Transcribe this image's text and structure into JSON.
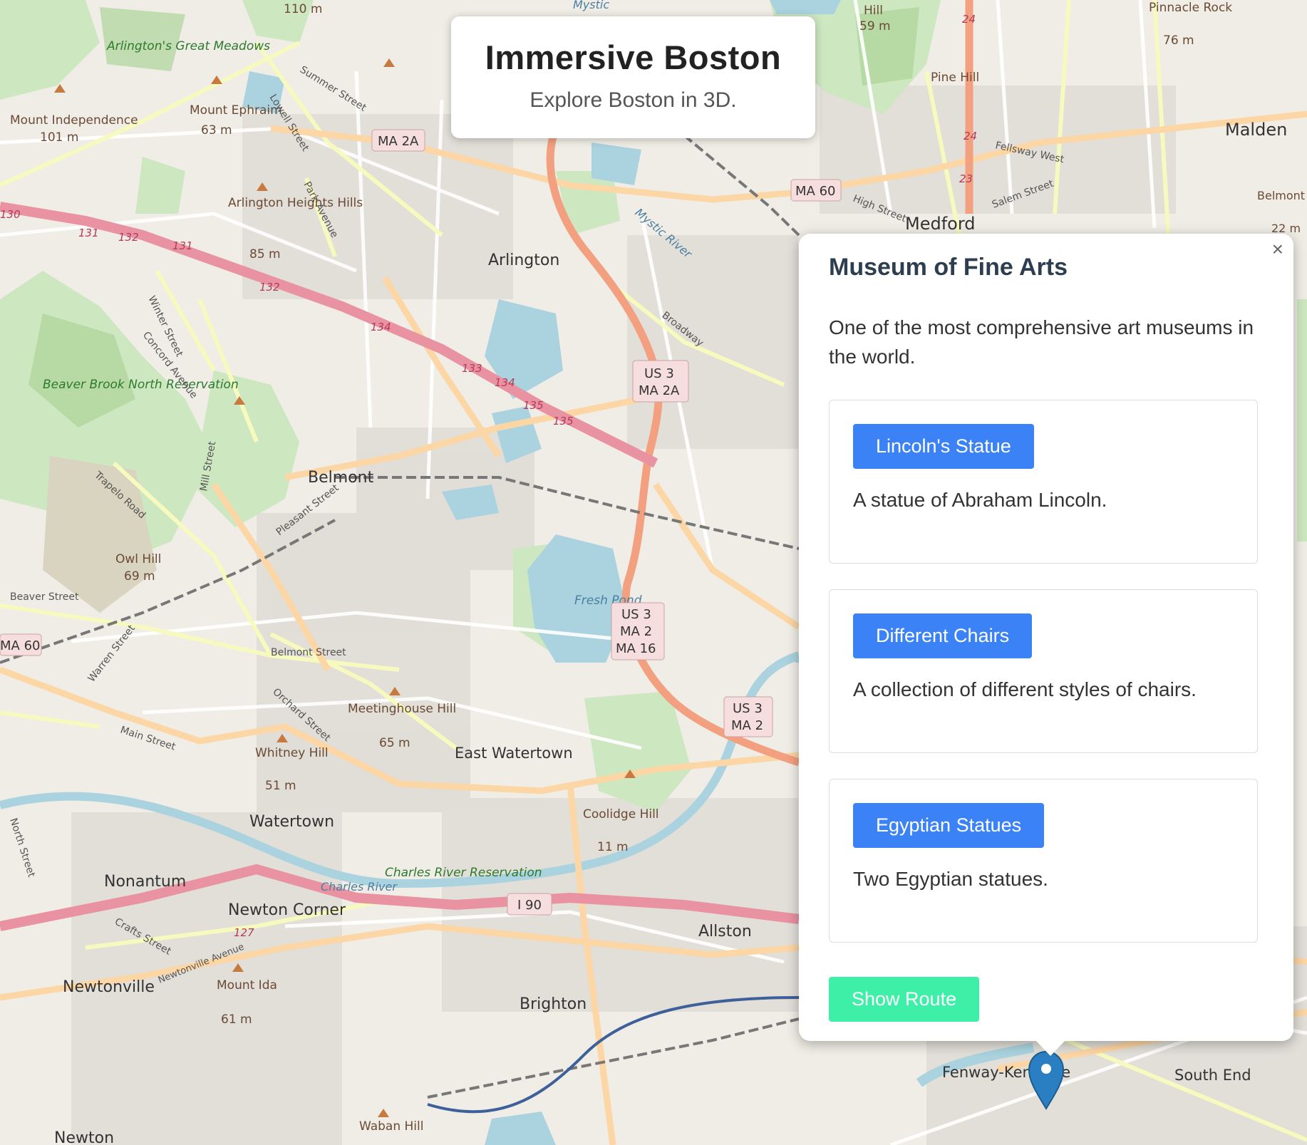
{
  "app": {
    "title": "Immersive Boston",
    "subtitle": "Explore Boston in 3D."
  },
  "popup": {
    "close_label": "×",
    "title": "Museum of Fine Arts",
    "description": "One of the most comprehensive art museums in the world.",
    "exhibits": [
      {
        "label": "Lincoln's Statue",
        "description": "A statue of Abraham Lincoln."
      },
      {
        "label": "Different Chairs",
        "description": "A collection of different styles of chairs."
      },
      {
        "label": "Egyptian Statues",
        "description": "Two Egyptian statues."
      }
    ],
    "route_label": "Show Route"
  },
  "map": {
    "towns": {
      "arlington": "Arlington",
      "belmont": "Belmont",
      "east_watertown": "East Watertown",
      "watertown": "Watertown",
      "nonantum": "Nonantum",
      "newton_corner": "Newton Corner",
      "newtonville": "Newtonville",
      "newton": "Newton",
      "brighton": "Brighton",
      "allston": "Allston",
      "medford": "Medford",
      "malden": "Malden",
      "fenway": "Fenway-Kenmore",
      "south_end": "South End"
    },
    "places": {
      "mt_independence": "Mount Independence",
      "mt_independence_elev": "101 m",
      "mt_ephraim": "Mount Ephraim",
      "mt_ephraim_elev": "63 m",
      "arlington_heights": "Arlington Heights Hills",
      "arlington_heights_elev": "85 m",
      "great_meadows": "Arlington's Great Meadows",
      "beaver_brook": "Beaver Brook North Reservation",
      "owl_hill": "Owl Hill",
      "owl_hill_elev": "69 m",
      "meetinghouse": "Meetinghouse Hill",
      "meetinghouse_elev": "65 m",
      "whitney": "Whitney Hill",
      "whitney_elev": "51 m",
      "coolidge": "Coolidge Hill",
      "coolidge_elev": "11 m",
      "mount_ida": "Mount Ida",
      "mount_ida_elev": "61 m",
      "fresh_pond": "Fresh Pond",
      "charles_res": "Charles River Reservation",
      "charles_river": "Charles River",
      "pine_hill": "Pine Hill",
      "pinnacle": "Pinnacle Rock",
      "pinnacle_elev": "76 m",
      "hill_59": "Hill",
      "hill_59_elev": "59 m",
      "belmont_hill": "Belmont Hill",
      "belmont_hill_elev": "22 m",
      "waban": "Waban Hill",
      "mystic": "Mystic",
      "mystic_river": "Mystic River",
      "elev_110": "110 m"
    },
    "roads": {
      "summer": "Summer Street",
      "lowell": "Lowell Street",
      "park": "Park Avenue",
      "winter": "Winter Street",
      "concord": "Concord Avenue",
      "trapelo": "Trapelo Road",
      "mill": "Mill Street",
      "pleasant": "Pleasant Street",
      "beaver": "Beaver Street",
      "belmont_st": "Belmont Street",
      "orchard": "Orchard Street",
      "warren": "Warren Street",
      "main": "Main Street",
      "north": "North Street",
      "crafts": "Crafts Street",
      "newtonville_ave": "Newtonville Avenue",
      "broadway": "Broadway",
      "high": "High Street",
      "salem": "Salem Street",
      "fellsway": "Fellsway West"
    },
    "shields": {
      "ma2a": "MA 2A",
      "ma60": "MA 60",
      "ma60w": "MA 60",
      "us3_ma2a": [
        "US 3",
        "MA 2A"
      ],
      "us3_ma2_ma16": [
        "US 3",
        "MA 2",
        "MA 16"
      ],
      "us3_ma2": [
        "US 3",
        "MA 2"
      ],
      "i90": "I 90"
    },
    "exits": [
      "130",
      "131",
      "132",
      "131",
      "132",
      "133",
      "134",
      "135",
      "135",
      "134",
      "127",
      "24",
      "24",
      "23"
    ]
  }
}
